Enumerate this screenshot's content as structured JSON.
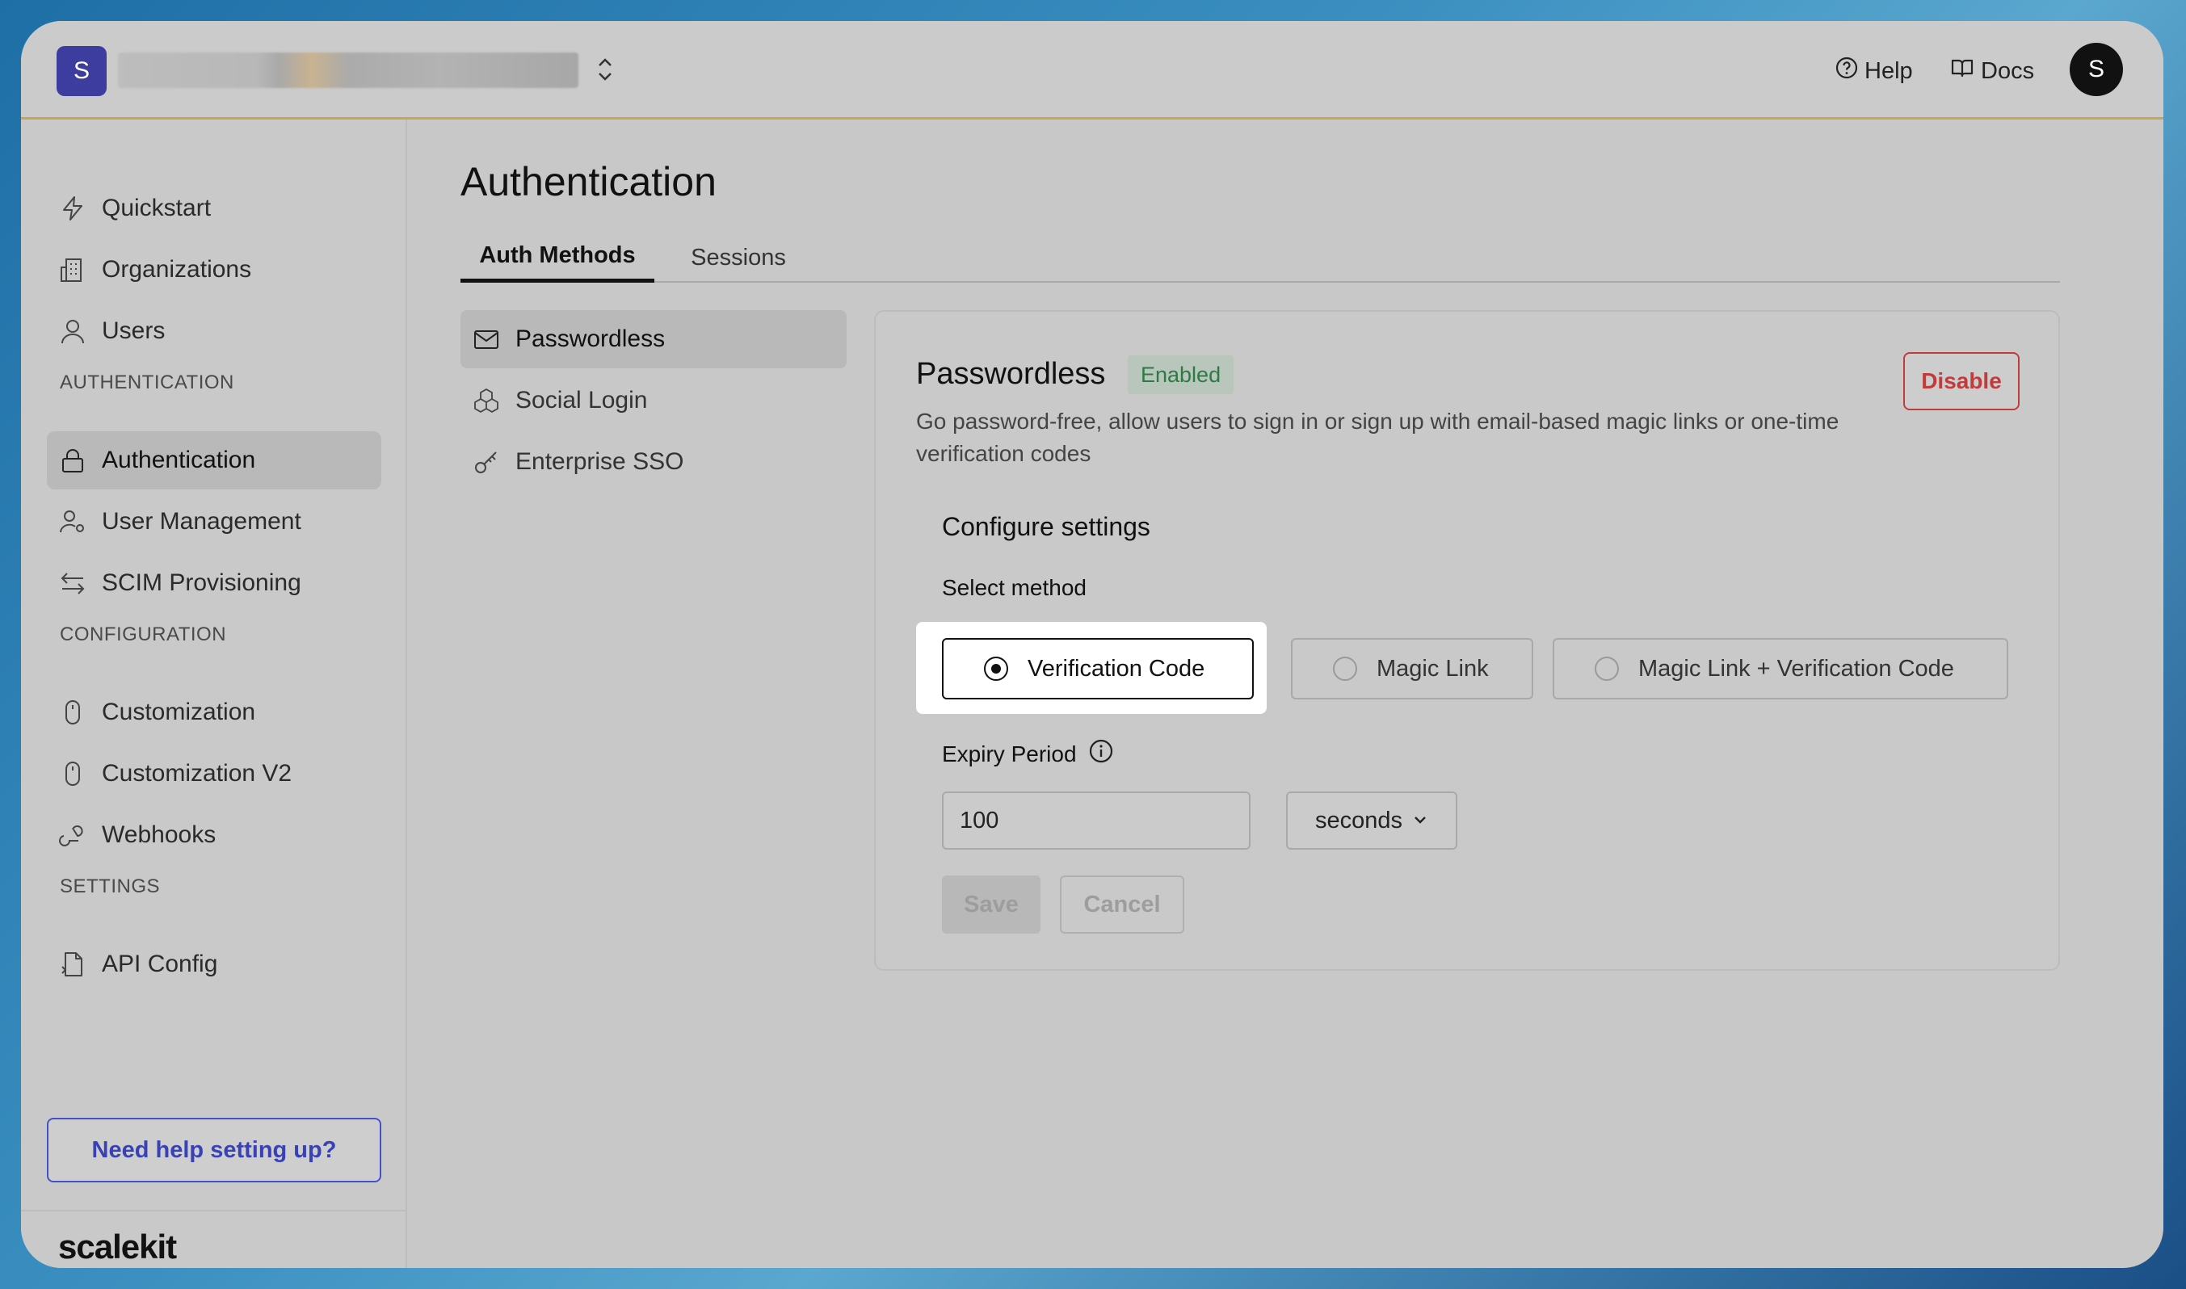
{
  "header": {
    "org_initial": "S",
    "help_label": "Help",
    "docs_label": "Docs",
    "user_initial": "S"
  },
  "sidebar": {
    "items": [
      {
        "label": "Quickstart",
        "icon": "lightning-icon"
      },
      {
        "label": "Organizations",
        "icon": "building-icon"
      },
      {
        "label": "Users",
        "icon": "user-icon"
      }
    ],
    "authentication_section": "AUTHENTICATION",
    "auth_items": [
      {
        "label": "Authentication",
        "icon": "lock-icon",
        "active": true
      },
      {
        "label": "User Management",
        "icon": "user-gear-icon"
      },
      {
        "label": "SCIM Provisioning",
        "icon": "arrows-swap-icon"
      }
    ],
    "configuration_section": "CONFIGURATION",
    "config_items": [
      {
        "label": "Customization",
        "icon": "mouse-icon"
      },
      {
        "label": "Customization V2",
        "icon": "mouse-icon"
      },
      {
        "label": "Webhooks",
        "icon": "webhook-icon"
      }
    ],
    "settings_section": "SETTINGS",
    "settings_items": [
      {
        "label": "API Config",
        "icon": "file-code-icon"
      }
    ],
    "help_button": "Need help setting up?",
    "brand": "scalekit"
  },
  "main": {
    "title": "Authentication",
    "tabs": [
      {
        "label": "Auth Methods",
        "active": true
      },
      {
        "label": "Sessions",
        "active": false
      }
    ],
    "methods": [
      {
        "label": "Passwordless",
        "icon": "mail-icon",
        "active": true
      },
      {
        "label": "Social Login",
        "icon": "cubes-icon"
      },
      {
        "label": "Enterprise SSO",
        "icon": "key-icon"
      }
    ],
    "card": {
      "title": "Passwordless",
      "badge": "Enabled",
      "disable_label": "Disable",
      "description": "Go password-free, allow users to sign in or sign up with email-based magic links or one-time verification codes",
      "configure_title": "Configure settings",
      "select_label": "Select method",
      "options": [
        {
          "label": "Verification Code",
          "selected": true
        },
        {
          "label": "Magic Link",
          "selected": false
        },
        {
          "label": "Magic Link + Verification Code",
          "selected": false
        }
      ],
      "expiry_label": "Expiry Period",
      "expiry_value": "100",
      "expiry_unit": "seconds",
      "save_label": "Save",
      "cancel_label": "Cancel"
    }
  },
  "colors": {
    "accent": "#3942b5",
    "danger": "#c23b3b",
    "success": "#2d7a45",
    "org_avatar": "#3c3d9e"
  }
}
